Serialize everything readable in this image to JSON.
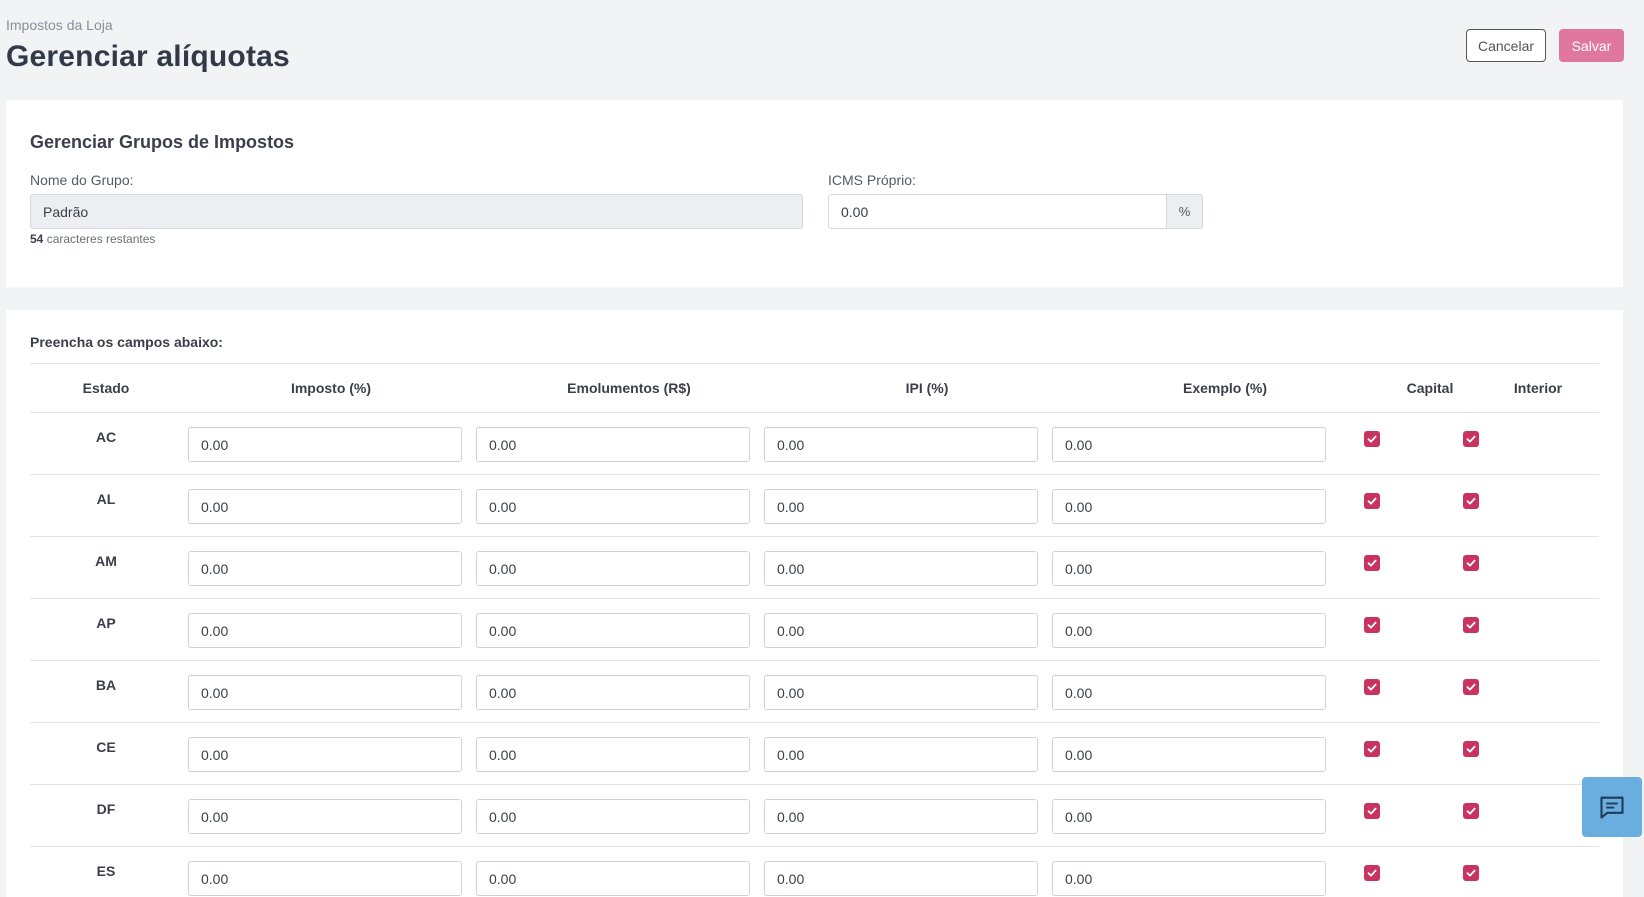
{
  "header": {
    "breadcrumb": "Impostos da Loja",
    "title": "Gerenciar alíquotas",
    "cancel_label": "Cancelar",
    "save_label": "Salvar"
  },
  "groups": {
    "title": "Gerenciar Grupos de Impostos",
    "name_label": "Nome do Grupo:",
    "name_value": "Padrão",
    "chars_count": "54",
    "chars_suffix": " caracteres restantes",
    "icms_label": "ICMS Próprio:",
    "icms_value": "0.00",
    "icms_unit": "%"
  },
  "table": {
    "intro": "Preencha os campos abaixo:",
    "headers": [
      "Estado",
      "Imposto (%)",
      "Emolumentos (R$)",
      "IPI (%)",
      "Exemplo (%)",
      "Capital",
      "Interior"
    ],
    "rows": [
      {
        "state": "AC",
        "imposto": "0.00",
        "emolumentos": "0.00",
        "ipi": "0.00",
        "exemplo": "0.00",
        "capital": true,
        "interior": true
      },
      {
        "state": "AL",
        "imposto": "0.00",
        "emolumentos": "0.00",
        "ipi": "0.00",
        "exemplo": "0.00",
        "capital": true,
        "interior": true
      },
      {
        "state": "AM",
        "imposto": "0.00",
        "emolumentos": "0.00",
        "ipi": "0.00",
        "exemplo": "0.00",
        "capital": true,
        "interior": true
      },
      {
        "state": "AP",
        "imposto": "0.00",
        "emolumentos": "0.00",
        "ipi": "0.00",
        "exemplo": "0.00",
        "capital": true,
        "interior": true
      },
      {
        "state": "BA",
        "imposto": "0.00",
        "emolumentos": "0.00",
        "ipi": "0.00",
        "exemplo": "0.00",
        "capital": true,
        "interior": true
      },
      {
        "state": "CE",
        "imposto": "0.00",
        "emolumentos": "0.00",
        "ipi": "0.00",
        "exemplo": "0.00",
        "capital": true,
        "interior": true
      },
      {
        "state": "DF",
        "imposto": "0.00",
        "emolumentos": "0.00",
        "ipi": "0.00",
        "exemplo": "0.00",
        "capital": true,
        "interior": true
      },
      {
        "state": "ES",
        "imposto": "0.00",
        "emolumentos": "0.00",
        "ipi": "0.00",
        "exemplo": "0.00",
        "capital": true,
        "interior": true
      }
    ]
  },
  "colors": {
    "accent": "#c8335f",
    "save_button": "#e0779c",
    "chat_button": "#6aaee0"
  },
  "icons": {
    "checkbox": "check-icon",
    "chat": "chat-icon"
  }
}
